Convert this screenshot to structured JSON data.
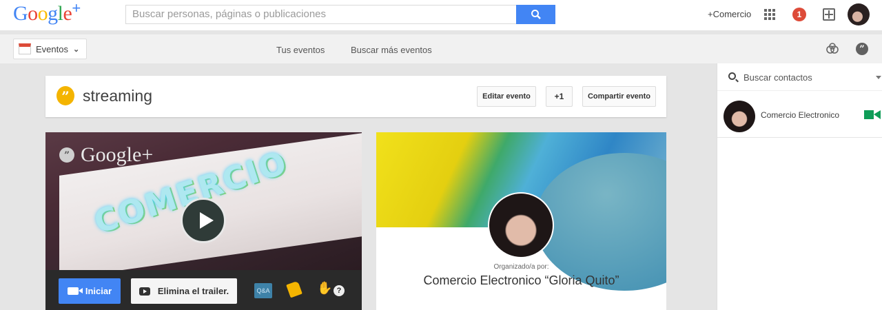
{
  "header": {
    "logo_letters": [
      "G",
      "o",
      "o",
      "g",
      "l",
      "e"
    ],
    "logo_plus": "+",
    "search_placeholder": "Buscar personas, páginas o publicaciones",
    "profile_link": "+Comercio",
    "notification_count": "1"
  },
  "subnav": {
    "section_label": "Eventos",
    "links": [
      "Tus eventos",
      "Buscar más eventos"
    ]
  },
  "event": {
    "title": "streaming",
    "actions": {
      "edit": "Editar evento",
      "plus_one": "+1",
      "share": "Compartir evento"
    }
  },
  "video": {
    "logo_text": "Google+",
    "logo_icon_glyph": "”",
    "graffiti_text": "COMERCIO",
    "start_label": "Iniciar",
    "trailer_label": "Elimina el trailer.",
    "qa_label": "Q&A",
    "help_glyph": "?"
  },
  "organizer": {
    "label": "Organizado/a por:",
    "name": "Comercio Electronico “Gloria Quito”"
  },
  "contacts": {
    "search_placeholder": "Buscar contactos",
    "items": [
      {
        "name": "Comercio Electronico"
      }
    ]
  },
  "colors": {
    "accent": "#4285f4",
    "notification": "#dd4b39",
    "hangouts": "#f4b400",
    "video_call": "#0f9d58"
  }
}
